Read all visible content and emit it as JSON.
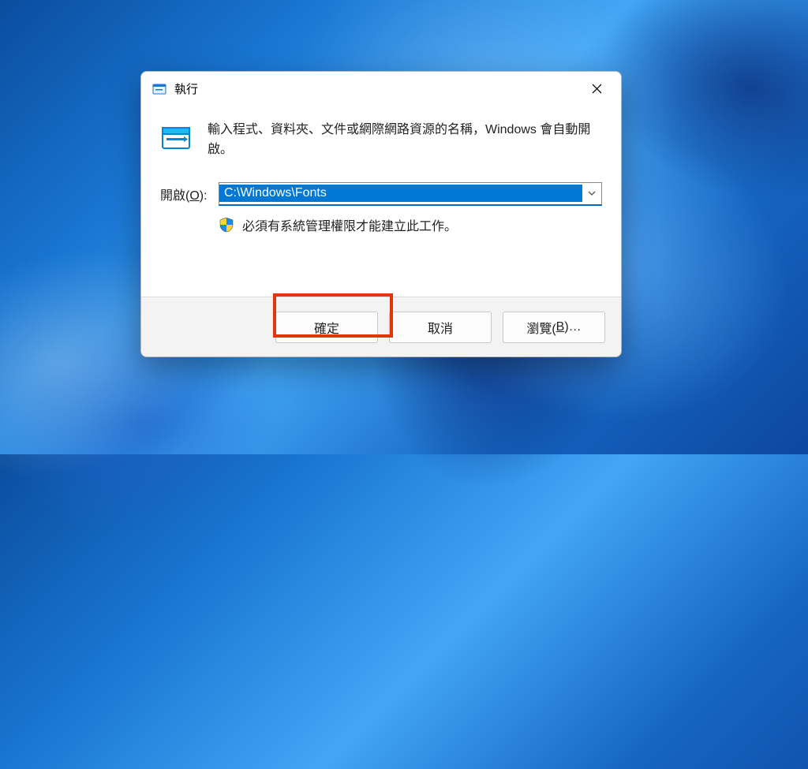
{
  "dialog": {
    "title": "執行",
    "description": "輸入程式、資料夾、文件或網際網路資源的名稱，Windows 會自動開啟。",
    "open_label_prefix": "開啟(",
    "open_label_accel": "O",
    "open_label_suffix": "):",
    "path_value": "C:\\Windows\\Fonts",
    "admin_notice": "必須有系統管理權限才能建立此工作。",
    "buttons": {
      "ok": "確定",
      "cancel": "取消",
      "browse_prefix": "瀏覽(",
      "browse_accel": "B",
      "browse_suffix": ")…"
    }
  },
  "colors": {
    "accent": "#0078d4",
    "highlight": "#e3350d"
  }
}
